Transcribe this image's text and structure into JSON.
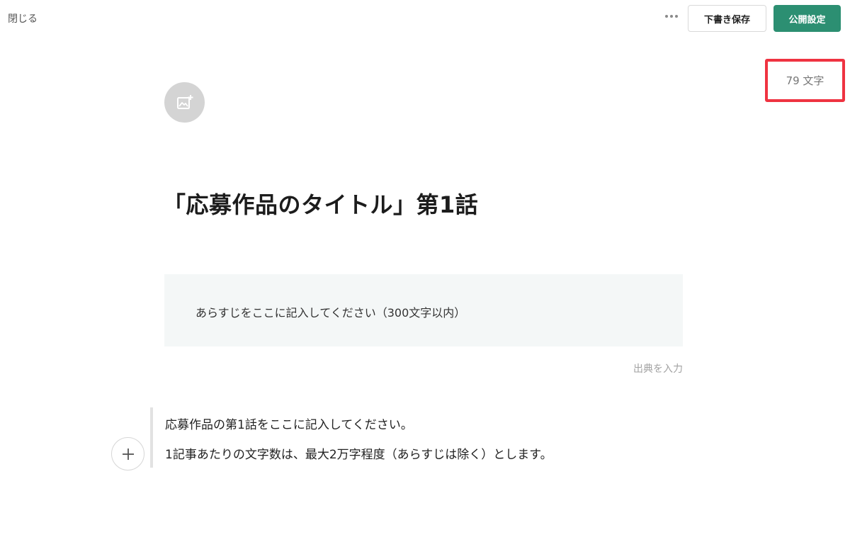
{
  "header": {
    "close_label": "閉じる",
    "more_icon": "more-dots-icon",
    "draft_save_label": "下書き保存",
    "publish_settings_label": "公開設定",
    "publish_color": "#2c8f72"
  },
  "char_count": {
    "text": "79 文字",
    "highlight_color": "#ef3341"
  },
  "editor": {
    "image_add_icon": "image-add-icon",
    "title": "「応募作品のタイトル」第1話",
    "synopsis": "あらすじをここに記入してください（300文字以内）",
    "source_placeholder": "出典を入力",
    "body_lines": [
      "応募作品の第1話をここに記入してください。",
      "1記事あたりの文字数は、最大2万字程度（あらすじは除く）とします。"
    ],
    "add_block_icon": "plus-icon"
  }
}
